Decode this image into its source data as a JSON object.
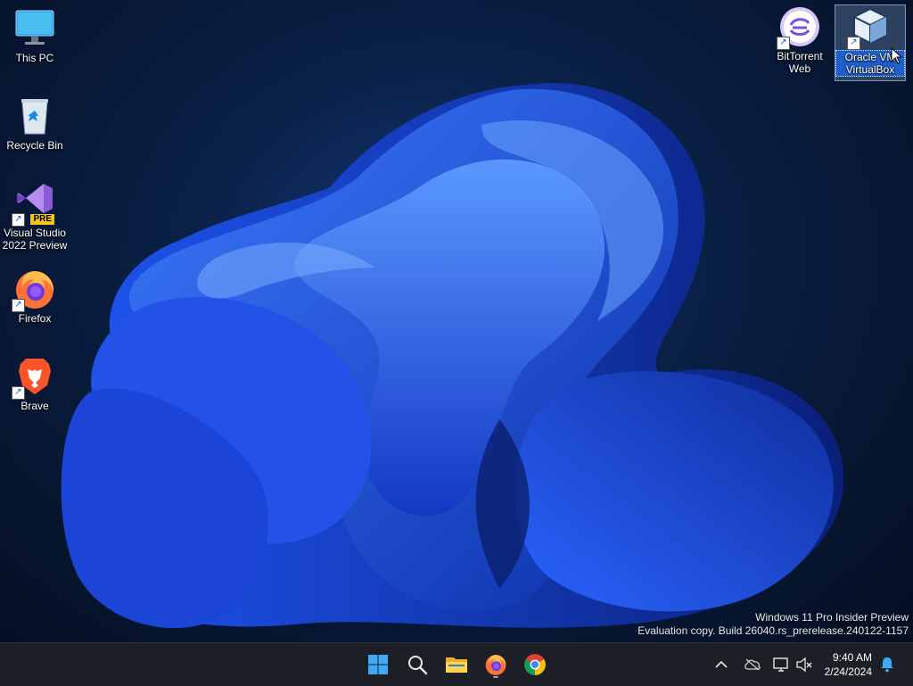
{
  "desktop": {
    "icons_left": [
      {
        "label": "This PC",
        "icon": "monitor-icon"
      },
      {
        "label": "Recycle Bin",
        "icon": "recycle-bin-icon"
      },
      {
        "label": "Visual Studio 2022 Preview",
        "icon": "visual-studio-icon",
        "badge": "PRE"
      },
      {
        "label": "Firefox",
        "icon": "firefox-icon"
      },
      {
        "label": "Brave",
        "icon": "brave-icon"
      }
    ],
    "icons_right": [
      {
        "label": "BitTorrent Web",
        "icon": "bittorrent-icon"
      },
      {
        "label": "Oracle VM VirtualBox",
        "icon": "virtualbox-icon",
        "selected": true
      }
    ]
  },
  "watermark": {
    "line1": "Windows 11 Pro Insider Preview",
    "line2": "Evaluation copy. Build 26040.rs_prerelease.240122-1157"
  },
  "taskbar": {
    "apps": [
      "start-icon",
      "search-icon",
      "file-explorer-icon",
      "firefox-icon",
      "chrome-icon"
    ],
    "clock": {
      "time": "9:40 AM",
      "date": "2/24/2024"
    },
    "tray": [
      "chevron-up-icon",
      "onedrive-icon",
      "network-icon",
      "volume-muted-icon",
      "notification-bell-icon"
    ]
  },
  "colors": {
    "taskbar_bg": "#1c1f26",
    "selection": "#1f5fc9",
    "accent": "#2f7bff"
  }
}
